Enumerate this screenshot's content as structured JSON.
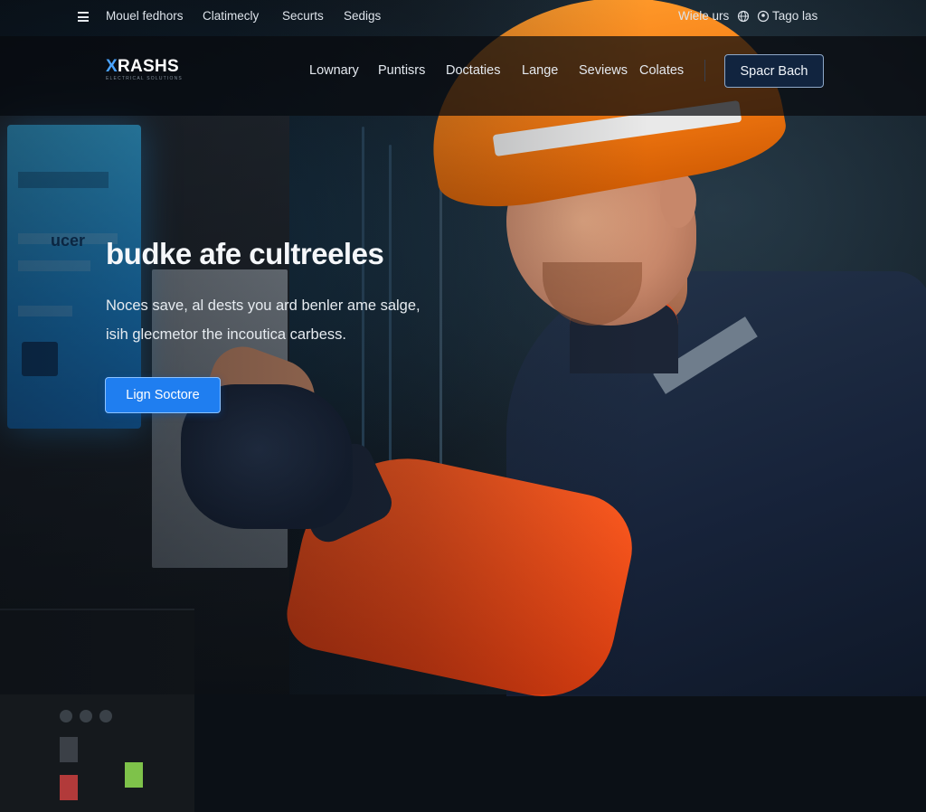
{
  "topbar": {
    "links": [
      "Mouel fedhors",
      "Clatimecly",
      "Securts",
      "Sedigs"
    ],
    "right_link": "Wiele urs",
    "account_label": "Tago las",
    "icons": [
      "menu-icon",
      "globe-icon",
      "user-icon"
    ]
  },
  "header": {
    "logo_text": "XRASHS",
    "logo_tagline": "ELECTRICAL SOLUTIONS",
    "nav": [
      "Lownary",
      "Puntisrs",
      "Doctaties",
      "Lange",
      "Seviews",
      "Colates"
    ],
    "cta_label": "Spacr Bach"
  },
  "hero": {
    "title": "budke afe cultreeles",
    "subtitle_line1": "Noces save, al dests you ard benler ame salge,",
    "subtitle_line2": "isih glecmetor the incoutica carbess.",
    "cta_label": "Lign Soctore",
    "screen_text": "ucer"
  },
  "colors": {
    "accent": "#1f7ef0",
    "nav_cta_bg": "#11243f",
    "helmet": "#f47a12",
    "sleeve": "#ff5a1f"
  }
}
